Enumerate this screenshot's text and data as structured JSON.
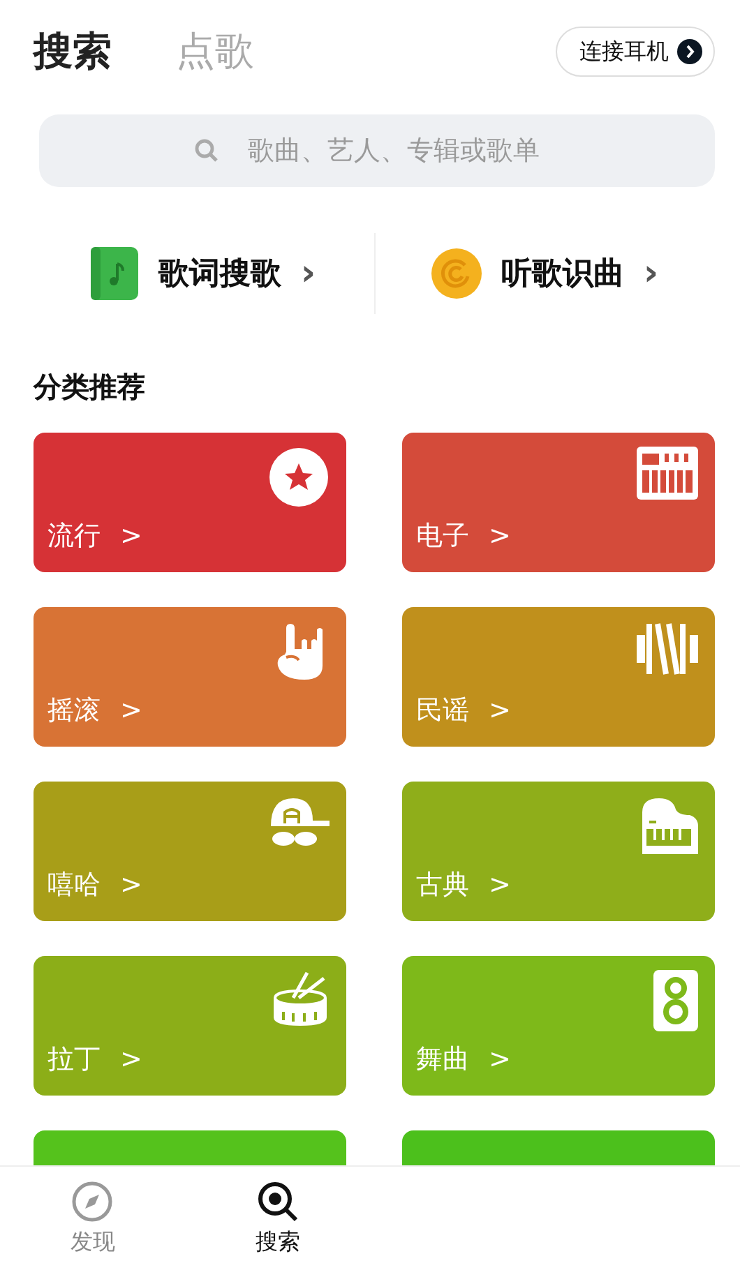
{
  "header_tabs": [
    {
      "label": "搜索",
      "selected": true
    },
    {
      "label": "点歌",
      "selected": false
    }
  ],
  "connect_button": {
    "label": "连接耳机"
  },
  "search": {
    "placeholder": "歌曲、艺人、专辑或歌单"
  },
  "quick_links": [
    {
      "label": "歌词搜歌",
      "arrow": "›"
    },
    {
      "label": "听歌识曲",
      "arrow": "›"
    }
  ],
  "section_title": "分类推荐",
  "categories": [
    {
      "label": "流行",
      "arrow": ">",
      "color": "#d63236"
    },
    {
      "label": "电子",
      "arrow": ">",
      "color": "#d44b3a"
    },
    {
      "label": "摇滚",
      "arrow": ">",
      "color": "#d87335"
    },
    {
      "label": "民谣",
      "arrow": ">",
      "color": "#c0901c"
    },
    {
      "label": "嘻哈",
      "arrow": ">",
      "color": "#a89e18"
    },
    {
      "label": "古典",
      "arrow": ">",
      "color": "#8fae1a"
    },
    {
      "label": "拉丁",
      "arrow": ">",
      "color": "#8cae18"
    },
    {
      "label": "舞曲",
      "arrow": ">",
      "color": "#7eb91a"
    }
  ],
  "partial_cards": [
    {
      "color": "#55c21c"
    },
    {
      "color": "#4cc01c"
    }
  ],
  "bottom_nav": [
    {
      "label": "发现",
      "selected": false
    },
    {
      "label": "搜索",
      "selected": true
    }
  ]
}
